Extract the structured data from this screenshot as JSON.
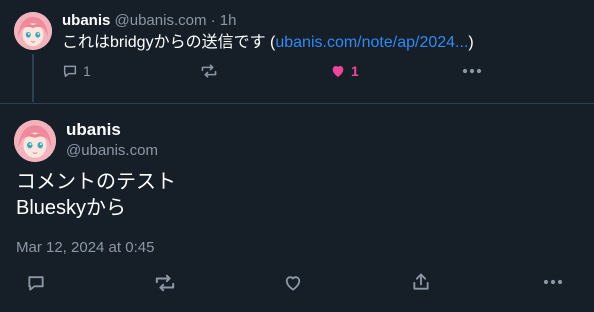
{
  "parent_post": {
    "display_name": "ubanis",
    "handle": "@ubanis.com",
    "separator": "·",
    "time": "1h",
    "text_prefix": "これはbridgyからの送信です (",
    "link_text": "ubanis.com/note/ap/2024...",
    "text_suffix": ")",
    "reply_count": "1",
    "like_count": "1",
    "liked": true,
    "colors": {
      "like_active": "#ec4899",
      "link": "#2f8af5"
    }
  },
  "main_post": {
    "display_name": "ubanis",
    "handle": "@ubanis.com",
    "lines": [
      "コメントのテスト",
      "Blueskyから"
    ],
    "date": "Mar 12, 2024 at 0:45"
  },
  "icons": {
    "reply": "speech-bubble-icon",
    "repost": "repost-arrows-icon",
    "like": "heart-icon",
    "share": "share-icon",
    "more": "more-dots-icon"
  }
}
